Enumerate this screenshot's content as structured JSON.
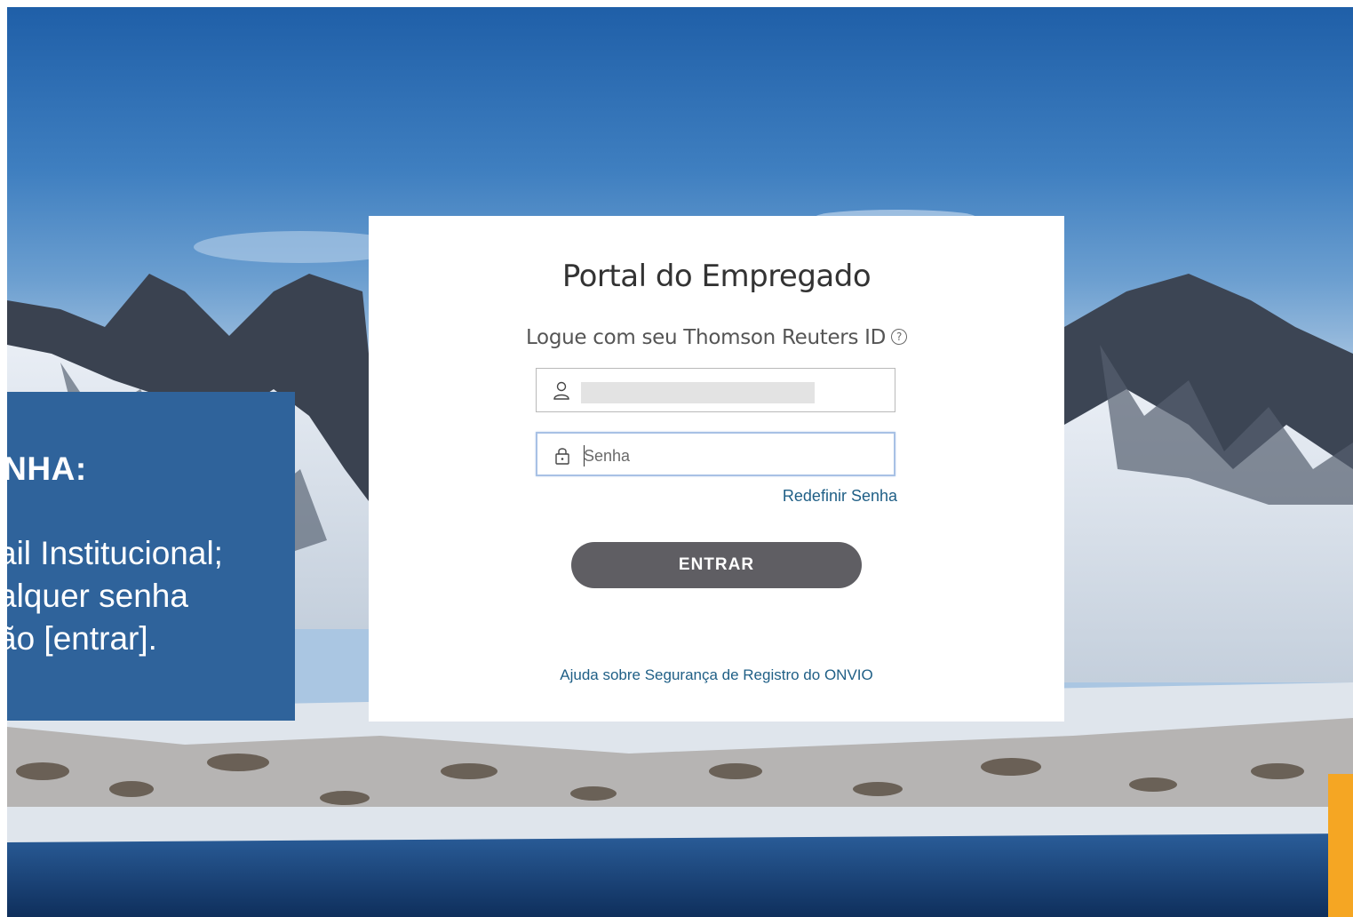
{
  "login": {
    "title": "Portal do Empregado",
    "subtitle": "Logue com seu Thomson Reuters ID",
    "help_icon_glyph": "?",
    "email_field": {
      "value": "",
      "icon": "user-icon"
    },
    "password_field": {
      "placeholder": "Senha",
      "icon": "lock-icon"
    },
    "reset_link": "Redefinir Senha",
    "submit_label": "ENTRAR",
    "security_help_link": "Ajuda sobre Segurança de Registro do ONVIO"
  },
  "info_panel": {
    "title": "ENHA:",
    "lines": [
      "ail Institucional;",
      "alquer senha",
      "ão [entrar]."
    ]
  },
  "colors": {
    "info_panel_bg": "#2f639b",
    "submit_bg": "#5f5e63",
    "link": "#1f5f86",
    "accent_tab": "#f5a623"
  }
}
